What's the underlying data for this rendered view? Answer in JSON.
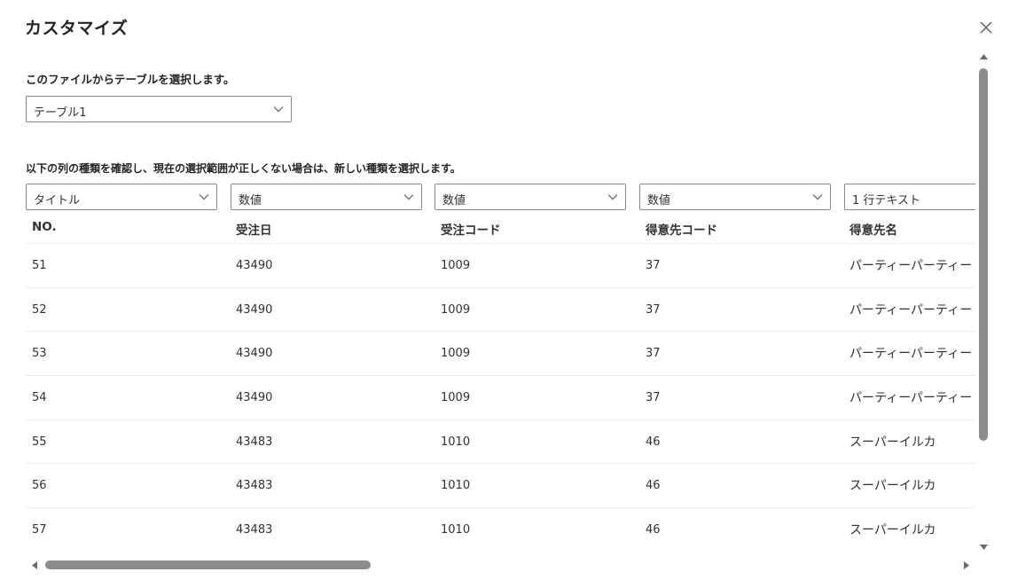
{
  "dialog": {
    "title": "カスタマイズ",
    "close_icon": "close-icon"
  },
  "table_picker": {
    "label": "このファイルからテーブルを選択します。",
    "selected": "テーブル1"
  },
  "columns_section": {
    "label": "以下の列の種類を確認し、現在の選択範囲が正しくない場合は、新しい種類を選択します。"
  },
  "column_types": [
    "タイトル",
    "数値",
    "数値",
    "数値",
    "1 行テキスト"
  ],
  "columns": [
    "NO.",
    "受注日",
    "受注コード",
    "得意先コード",
    "得意先名"
  ],
  "rows": [
    [
      "51",
      "43490",
      "1009",
      "37",
      "パーティーパーティー"
    ],
    [
      "52",
      "43490",
      "1009",
      "37",
      "パーティーパーティー"
    ],
    [
      "53",
      "43490",
      "1009",
      "37",
      "パーティーパーティー"
    ],
    [
      "54",
      "43490",
      "1009",
      "37",
      "パーティーパーティー"
    ],
    [
      "55",
      "43483",
      "1010",
      "46",
      "スーパーイルカ"
    ],
    [
      "56",
      "43483",
      "1010",
      "46",
      "スーパーイルカ"
    ],
    [
      "57",
      "43483",
      "1010",
      "46",
      "スーパーイルカ"
    ]
  ],
  "colors": {
    "text": "#242424",
    "border": "#8a8886",
    "row_divider": "#edebe9",
    "scrollbar_thumb": "#8c8c8c"
  }
}
